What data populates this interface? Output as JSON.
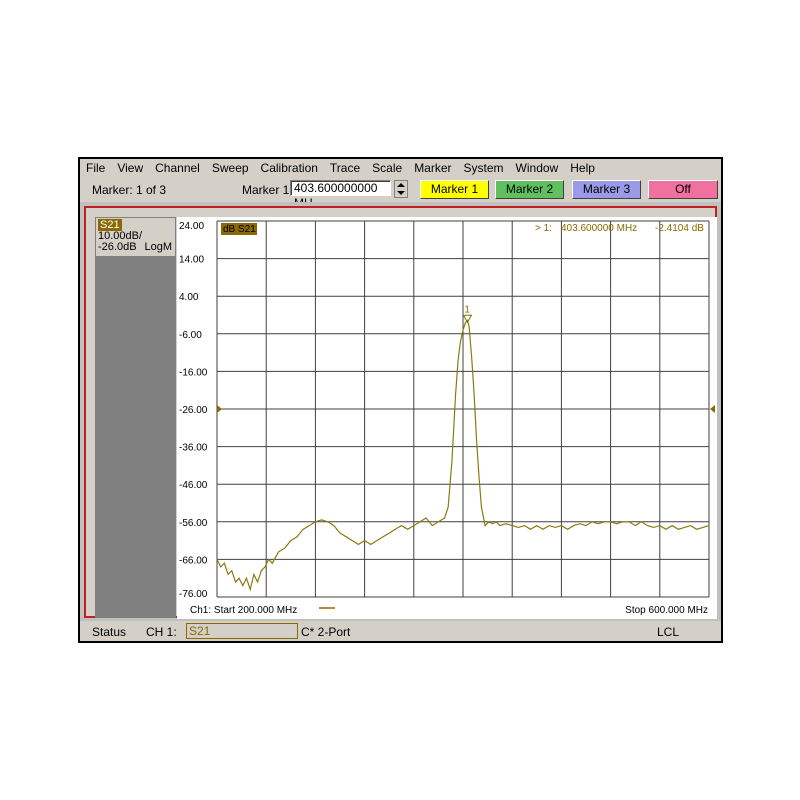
{
  "menu": [
    "File",
    "View",
    "Channel",
    "Sweep",
    "Calibration",
    "Trace",
    "Scale",
    "Marker",
    "System",
    "Window",
    "Help"
  ],
  "toolbar": {
    "marker_count": "Marker: 1 of 3",
    "marker_name": "Marker 1",
    "marker_freq": "403.600000000 MH",
    "buttons": [
      "Marker 1",
      "Marker 2",
      "Marker 3",
      "Off"
    ]
  },
  "trace_info": {
    "tag": "S21",
    "scale": "10.00dB/",
    "ref": "-26.0dB",
    "format": "LogM"
  },
  "chart_data": {
    "type": "line",
    "legend_label": "dB S21",
    "marker_readout": {
      "label": "> 1:",
      "freq": "403.600000 MHz",
      "value": "-2.4104 dB"
    },
    "marker_label": "1",
    "ylim": [
      -76,
      24
    ],
    "xlim": [
      200,
      600
    ],
    "yticks": [
      "24.00",
      "14.00",
      "4.00",
      "-6.00",
      "-16.00",
      "-26.00",
      "-36.00",
      "-46.00",
      "-56.00",
      "-66.00",
      "-76.00"
    ],
    "start_label": "Ch1: Start  200.000 MHz",
    "stop_label": "Stop  600.000 MHz",
    "series": [
      {
        "color": "#8a7a10",
        "x": [
          200,
          203,
          206,
          209,
          212,
          215,
          218,
          221,
          224,
          227,
          230,
          233,
          236,
          239,
          242,
          245,
          250,
          255,
          260,
          265,
          270,
          275,
          280,
          285,
          290,
          295,
          300,
          305,
          310,
          315,
          320,
          325,
          330,
          335,
          340,
          345,
          350,
          355,
          360,
          365,
          370,
          375,
          380,
          385,
          388,
          391,
          394,
          396,
          398,
          400,
          402,
          403.6,
          405,
          407,
          409,
          411,
          413,
          415,
          418,
          421,
          424,
          427,
          430,
          435,
          440,
          445,
          450,
          455,
          460,
          465,
          470,
          475,
          480,
          485,
          490,
          495,
          500,
          505,
          510,
          515,
          520,
          525,
          530,
          535,
          540,
          545,
          550,
          555,
          560,
          565,
          570,
          575,
          580,
          585,
          590,
          595,
          600
        ],
        "y": [
          -66,
          -68,
          -67,
          -70,
          -69,
          -72,
          -71,
          -73,
          -71,
          -74,
          -70,
          -72,
          -69,
          -68,
          -66,
          -67,
          -64,
          -63,
          -61,
          -60,
          -58,
          -57,
          -56,
          -55.5,
          -56,
          -57,
          -59,
          -60,
          -61,
          -62,
          -61,
          -62,
          -61,
          -60,
          -59,
          -58,
          -57,
          -58,
          -57,
          -56,
          -55,
          -57,
          -56,
          -55,
          -52,
          -40,
          -22,
          -13,
          -8,
          -5,
          -3,
          -2.4,
          -4,
          -12,
          -22,
          -34,
          -44,
          -52,
          -57,
          -56,
          -56.5,
          -56,
          -57,
          -56.5,
          -57,
          -57.5,
          -57,
          -58,
          -57,
          -58,
          -57,
          -57.5,
          -57,
          -58,
          -57,
          -56.5,
          -57,
          -56,
          -56.5,
          -56,
          -56,
          -56.5,
          -56,
          -56,
          -57,
          -56,
          -57,
          -57.5,
          -57,
          -58,
          -57,
          -58,
          -57.5,
          -57,
          -58,
          -57.5,
          -57
        ]
      }
    ]
  },
  "status": {
    "label": "Status",
    "channel": "CH 1:",
    "trace": "S21",
    "cal": "C* 2-Port",
    "mode": "LCL"
  }
}
